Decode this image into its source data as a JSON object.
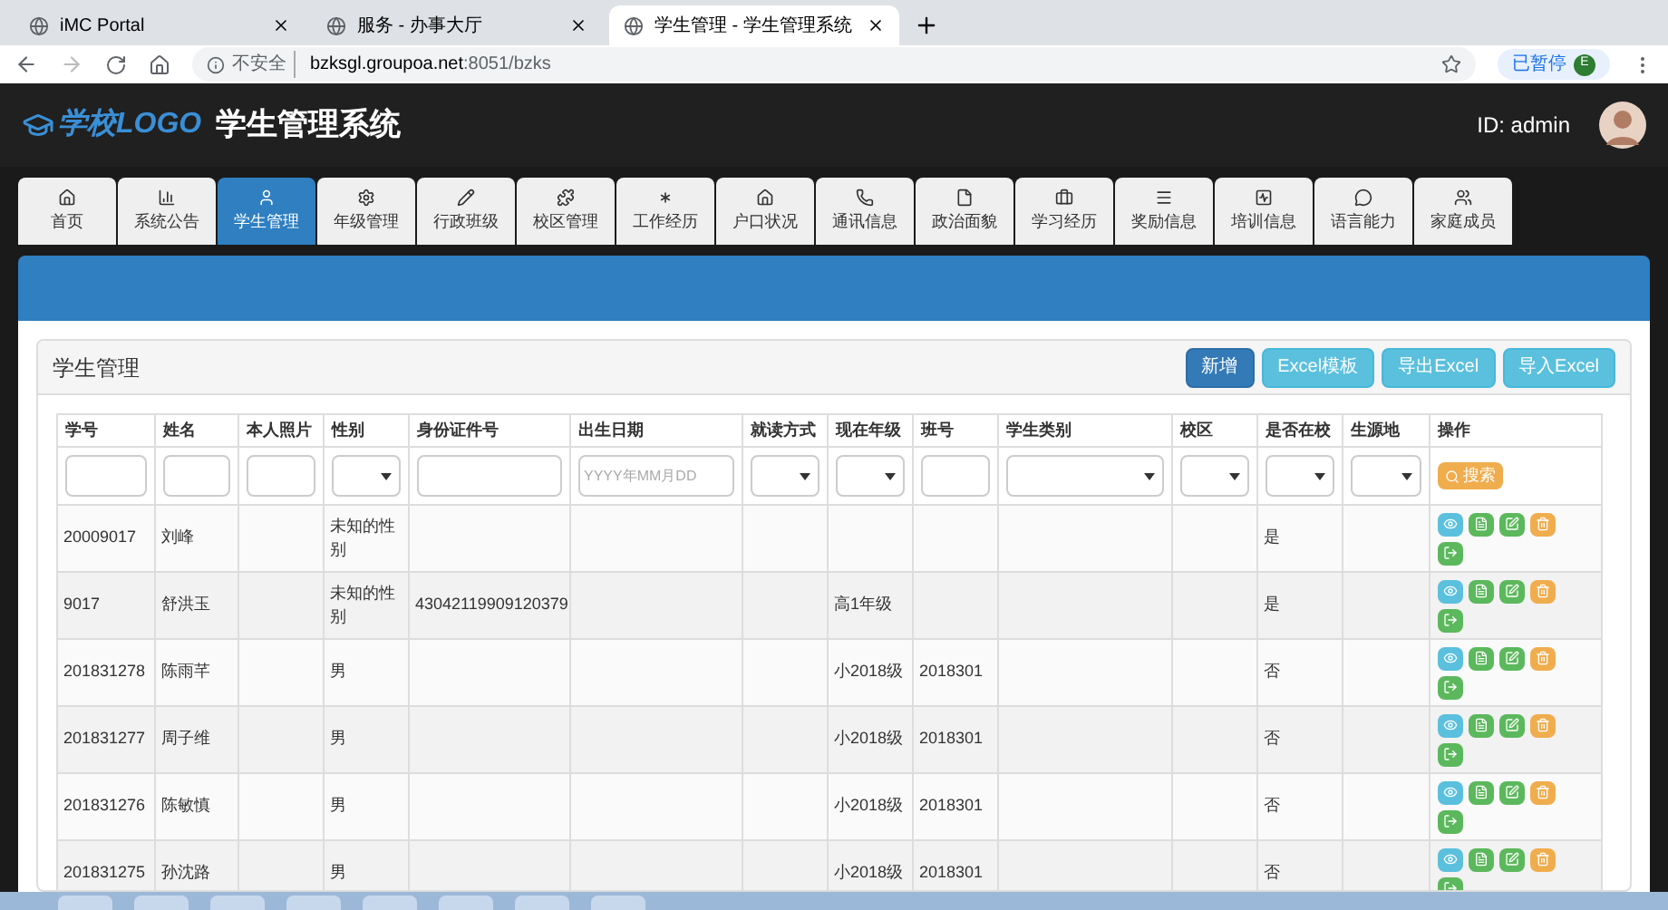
{
  "browser": {
    "tabs": [
      {
        "title": "iMC Portal",
        "selected": false
      },
      {
        "title": "服务 - 办事大厅",
        "selected": false
      },
      {
        "title": "学生管理 - 学生管理系统",
        "selected": true
      }
    ],
    "security": "不安全",
    "url_host": "bzksgl.groupoa.net",
    "url_path": ":8051/bzks",
    "paused": "已暂停",
    "profile": "E"
  },
  "header": {
    "logo": "学校LOGO",
    "title": "学生管理系统",
    "user": "ID: admin"
  },
  "nav": [
    {
      "label": "首页",
      "selected": false
    },
    {
      "label": "系统公告",
      "selected": false
    },
    {
      "label": "学生管理",
      "selected": true
    },
    {
      "label": "年级管理",
      "selected": false
    },
    {
      "label": "行政班级",
      "selected": false
    },
    {
      "label": "校区管理",
      "selected": false
    },
    {
      "label": "工作经历",
      "selected": false
    },
    {
      "label": "户口状况",
      "selected": false
    },
    {
      "label": "通讯信息",
      "selected": false
    },
    {
      "label": "政治面貌",
      "selected": false
    },
    {
      "label": "学习经历",
      "selected": false
    },
    {
      "label": "奖励信息",
      "selected": false
    },
    {
      "label": "培训信息",
      "selected": false
    },
    {
      "label": "语言能力",
      "selected": false
    },
    {
      "label": "家庭成员",
      "selected": false
    }
  ],
  "panel": {
    "title": "学生管理",
    "buttons": [
      {
        "label": "新增",
        "kind": "primary"
      },
      {
        "label": "Excel模板",
        "kind": "info"
      },
      {
        "label": "导出Excel",
        "kind": "info"
      },
      {
        "label": "导入Excel",
        "kind": "info"
      }
    ]
  },
  "table": {
    "columns": [
      "学号",
      "姓名",
      "本人照片",
      "性别",
      "身份证件号",
      "出生日期",
      "就读方式",
      "现在年级",
      "班号",
      "学生类别",
      "校区",
      "是否在校",
      "生源地",
      "操作"
    ],
    "filters": [
      {
        "kind": "text"
      },
      {
        "kind": "text"
      },
      {
        "kind": "text"
      },
      {
        "kind": "select"
      },
      {
        "kind": "text"
      },
      {
        "kind": "date",
        "placeholder": "YYYY年MM月DD"
      },
      {
        "kind": "select"
      },
      {
        "kind": "select"
      },
      {
        "kind": "text"
      },
      {
        "kind": "select"
      },
      {
        "kind": "select"
      },
      {
        "kind": "select"
      },
      {
        "kind": "select"
      },
      {
        "kind": "search",
        "label": "搜索"
      }
    ],
    "rows": [
      {
        "cells": [
          "20009017",
          "刘峰",
          "",
          "未知的性别",
          "",
          "",
          "",
          "",
          "",
          "",
          "",
          "是",
          ""
        ]
      },
      {
        "cells": [
          "9017",
          "舒洪玉",
          "",
          "未知的性别",
          "43042119909120379",
          "",
          "",
          "高1年级",
          "",
          "",
          "",
          "是",
          ""
        ]
      },
      {
        "cells": [
          "201831278",
          "陈雨芊",
          "",
          "男",
          "",
          "",
          "",
          "小2018级",
          "2018301",
          "",
          "",
          "否",
          ""
        ]
      },
      {
        "cells": [
          "201831277",
          "周子维",
          "",
          "男",
          "",
          "",
          "",
          "小2018级",
          "2018301",
          "",
          "",
          "否",
          ""
        ]
      },
      {
        "cells": [
          "201831276",
          "陈敏慎",
          "",
          "男",
          "",
          "",
          "",
          "小2018级",
          "2018301",
          "",
          "",
          "否",
          ""
        ]
      },
      {
        "cells": [
          "201831275",
          "孙沈路",
          "",
          "男",
          "",
          "",
          "",
          "小2018级",
          "2018301",
          "",
          "",
          "否",
          ""
        ]
      }
    ]
  }
}
